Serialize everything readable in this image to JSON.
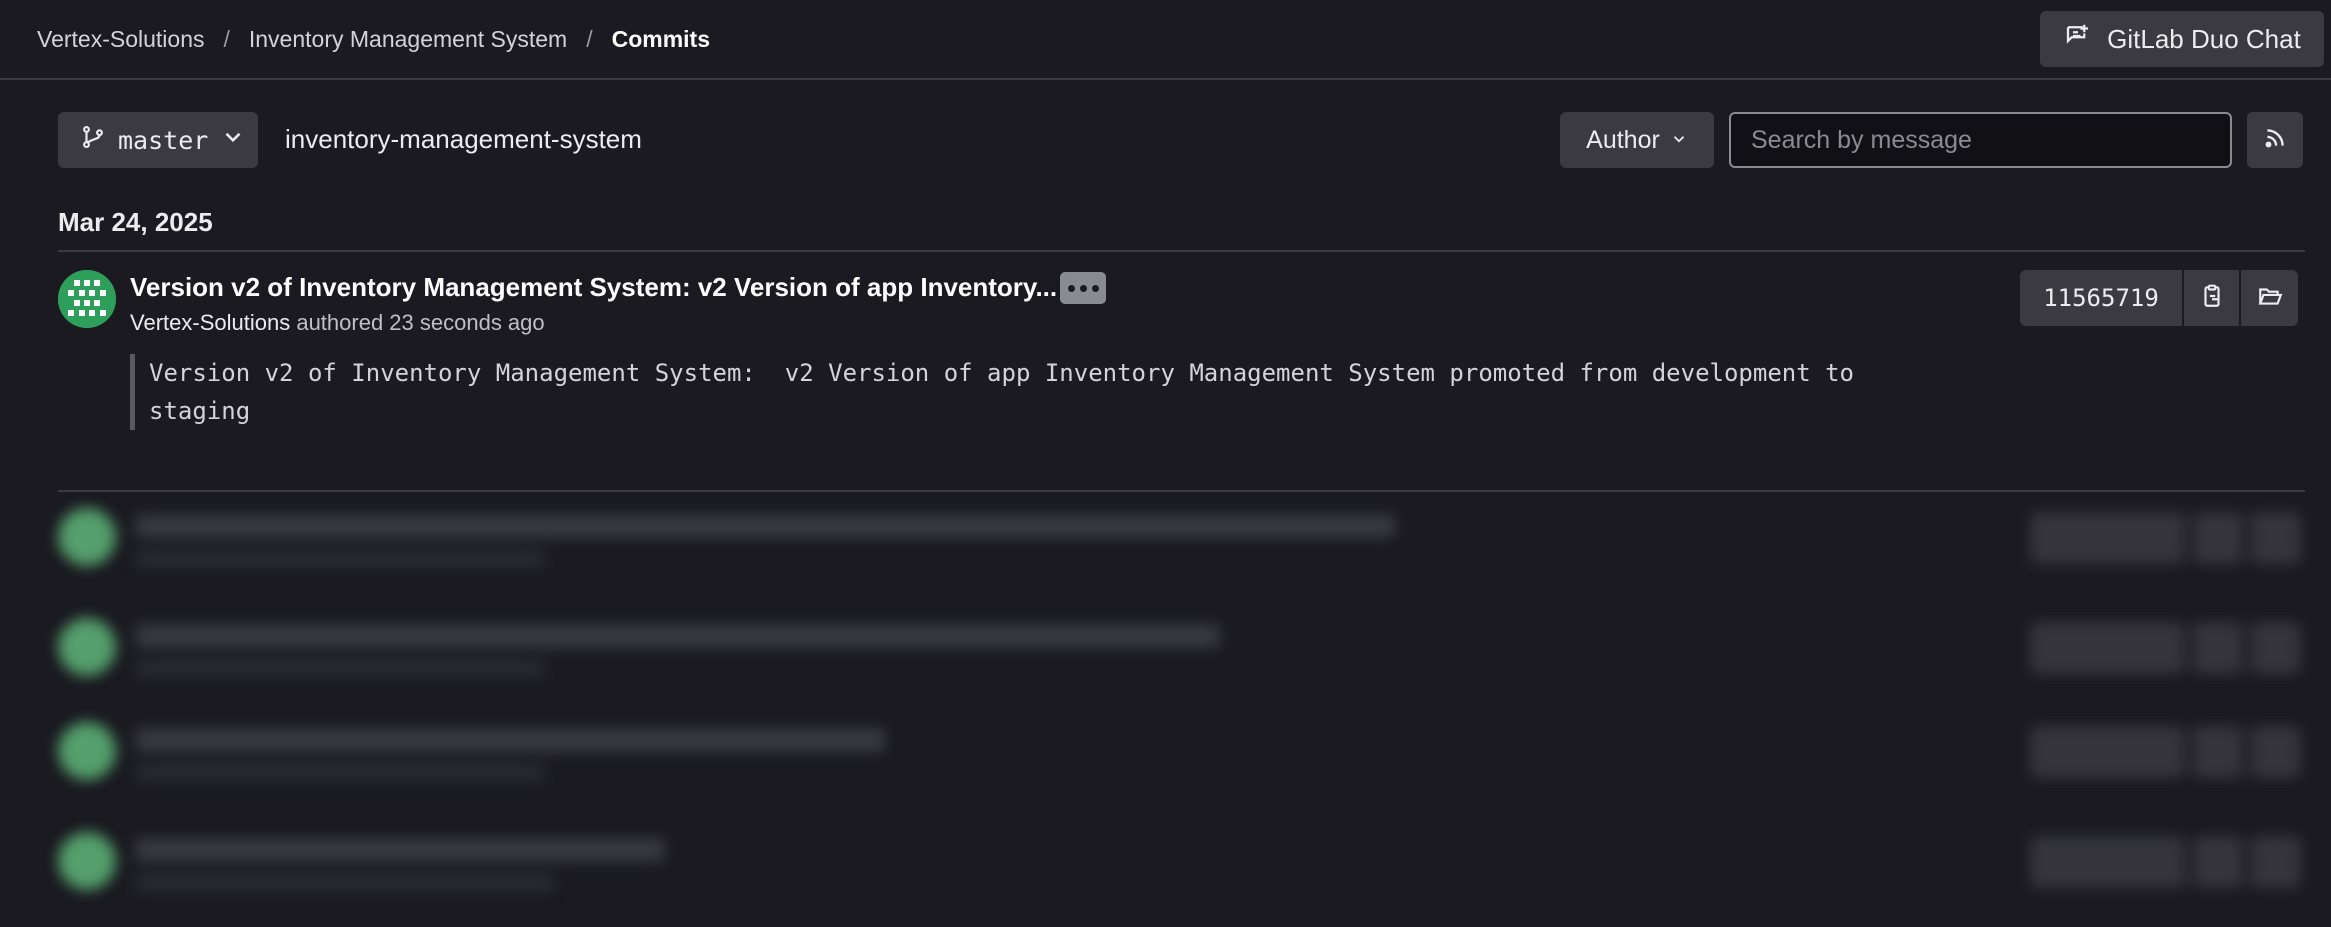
{
  "breadcrumb": {
    "items": [
      "Vertex-Solutions",
      "Inventory Management System",
      "Commits"
    ],
    "separator": "/"
  },
  "header": {
    "duo_chat_label": "GitLab Duo Chat"
  },
  "toolbar": {
    "branch": "master",
    "project_name": "inventory-management-system",
    "author_label": "Author",
    "search_placeholder": "Search by message"
  },
  "commits_section": {
    "date": "Mar 24, 2025",
    "commit": {
      "title": "Version v2 of Inventory Management System: v2 Version of app Inventory...",
      "author": "Vertex-Solutions",
      "authored_text": "authored 23 seconds ago",
      "sha": "11565719",
      "description": "Version v2 of Inventory Management System:  v2 Version of app Inventory Management System promoted from development to\nstaging"
    }
  },
  "colors": {
    "background": "#1a1a20",
    "button_bg": "#3a3a40",
    "avatar_green": "#2e9e5b"
  }
}
